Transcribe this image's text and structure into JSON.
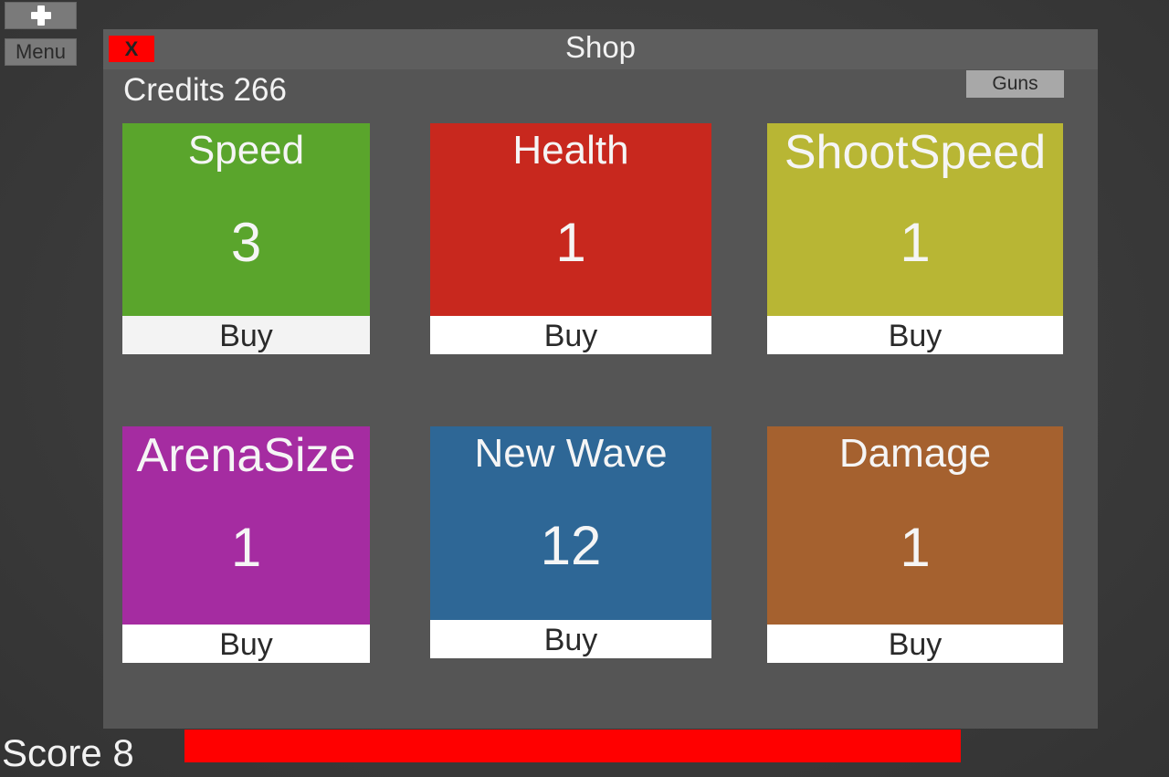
{
  "hud": {
    "add_icon": "plus-icon",
    "menu_label": "Menu",
    "score_label": "Score 8",
    "health_fraction": 1.0,
    "health_color": "#ff0000"
  },
  "shop": {
    "title": "Shop",
    "close_label": "X",
    "credits_label": "Credits 266",
    "guns_label": "Guns",
    "items": [
      {
        "name": "Speed",
        "level": "3",
        "buy": "Buy",
        "color": "#5aa52c"
      },
      {
        "name": "Health",
        "level": "1",
        "buy": "Buy",
        "color": "#c8281e"
      },
      {
        "name": "ShootSpeed",
        "level": "1",
        "buy": "Buy",
        "color": "#b8b634"
      },
      {
        "name": "ArenaSize",
        "level": "1",
        "buy": "Buy",
        "color": "#a52ca1"
      },
      {
        "name": "New Wave",
        "level": "12",
        "buy": "Buy",
        "color": "#2e6796"
      },
      {
        "name": "Damage",
        "level": "1",
        "buy": "Buy",
        "color": "#a5612f"
      }
    ]
  }
}
